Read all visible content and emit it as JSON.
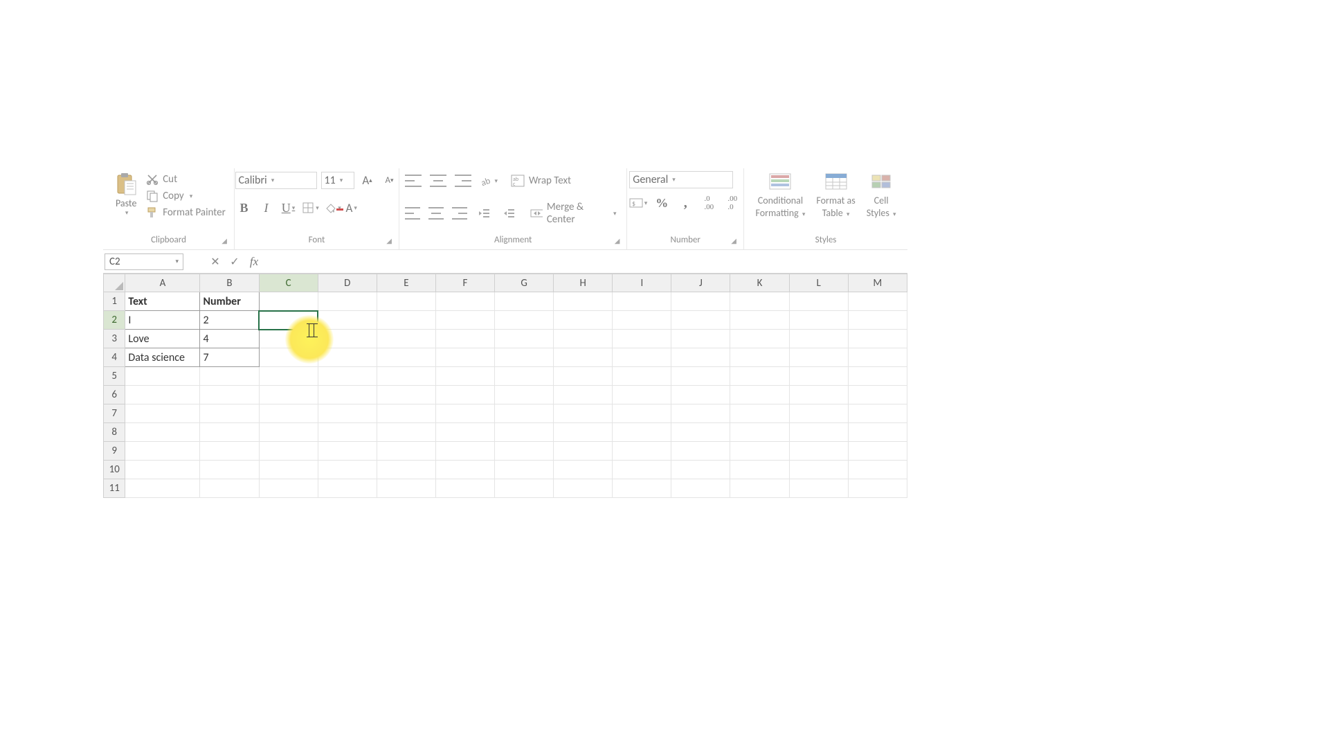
{
  "ribbon": {
    "clipboard": {
      "title": "Clipboard",
      "paste": "Paste",
      "cut": "Cut",
      "copy": "Copy",
      "format_painter": "Format Painter"
    },
    "font": {
      "title": "Font",
      "name": "Calibri",
      "size": "11"
    },
    "alignment": {
      "title": "Alignment",
      "wrap": "Wrap Text",
      "merge": "Merge & Center"
    },
    "number": {
      "title": "Number",
      "format": "General"
    },
    "styles": {
      "title": "Styles",
      "conditional": "Conditional",
      "formatting": "Formatting",
      "format_as": "Format as",
      "table": "Table",
      "cell": "Cell",
      "styles_word": "Styles"
    }
  },
  "namebox": "C2",
  "formula": "",
  "columns": [
    "A",
    "B",
    "C",
    "D",
    "E",
    "F",
    "G",
    "H",
    "I",
    "J",
    "K",
    "L",
    "M"
  ],
  "rows": [
    "1",
    "2",
    "3",
    "4",
    "5",
    "6",
    "7",
    "8",
    "9",
    "10",
    "11"
  ],
  "data": {
    "A1": "Text",
    "B1": "Number",
    "A2": "I",
    "B2": "2",
    "A3": "Love",
    "B3": "4",
    "A4": "Data science",
    "B4": "7"
  },
  "selected_cell": "C2"
}
